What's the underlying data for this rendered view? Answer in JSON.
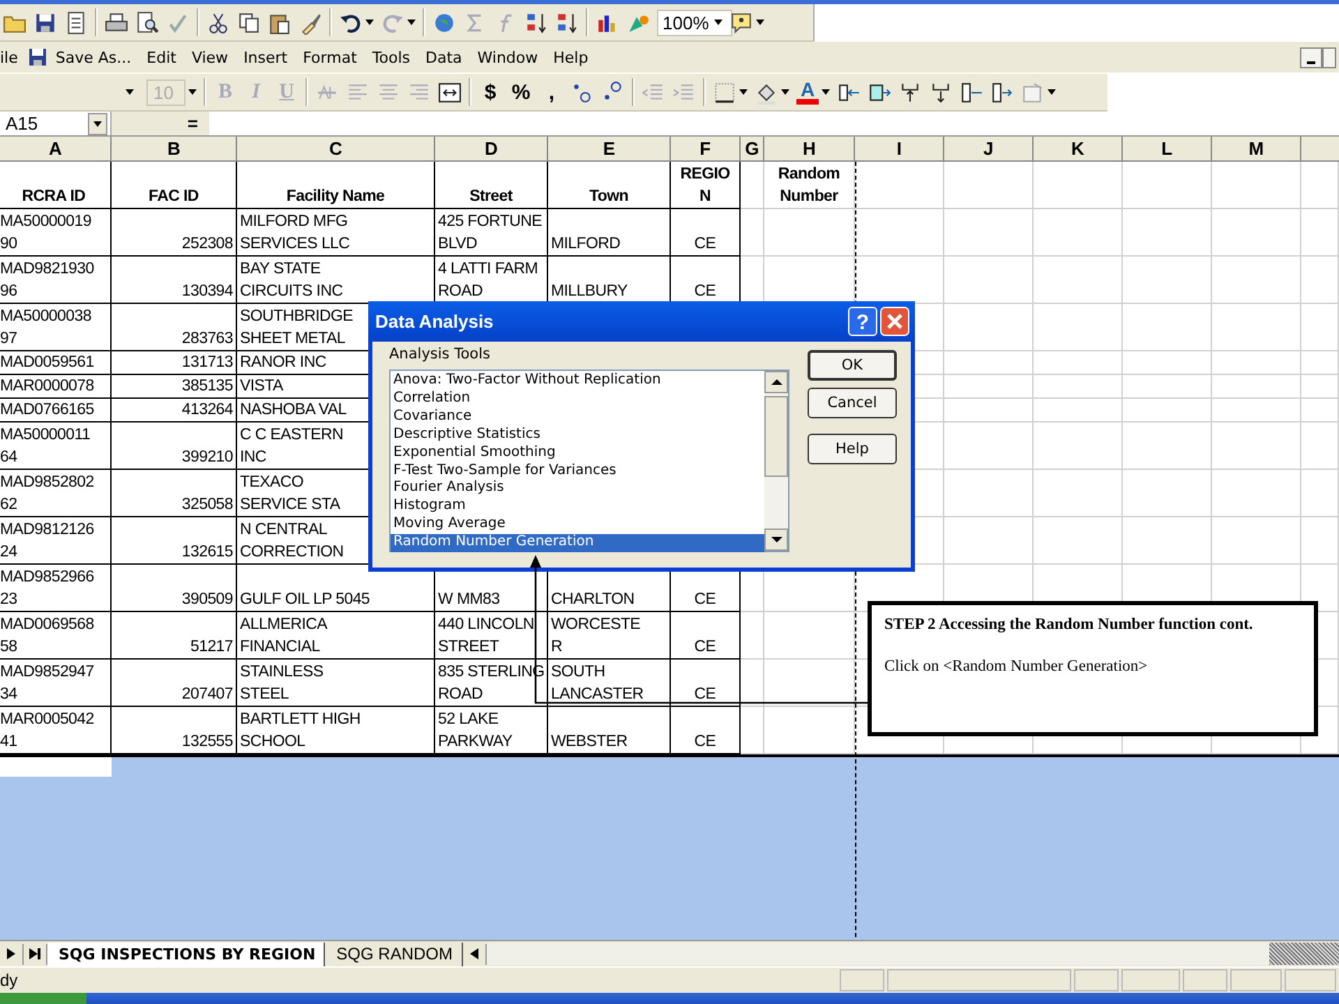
{
  "toolbar": {
    "zoom": "100%"
  },
  "menu": [
    {
      "label": "ile",
      "kind": "plain"
    },
    {
      "label": "Save As...",
      "kind": "save"
    },
    {
      "label": "Edit",
      "kind": "plain"
    },
    {
      "label": "View",
      "kind": "plain"
    },
    {
      "label": "Insert",
      "kind": "plain"
    },
    {
      "label": "Format",
      "kind": "plain"
    },
    {
      "label": "Tools",
      "kind": "plain"
    },
    {
      "label": "Data",
      "kind": "plain"
    },
    {
      "label": "Window",
      "kind": "plain"
    },
    {
      "label": "Help",
      "kind": "plain"
    }
  ],
  "format_toolbar": {
    "font_size": "10",
    "style_buttons": [
      "B",
      "I",
      "U"
    ],
    "number_buttons": [
      "$",
      "%",
      ","
    ],
    "font_color": "A"
  },
  "formula_bar": {
    "name_box": "A15",
    "equals": "="
  },
  "table": {
    "columns": [
      "A",
      "B",
      "C",
      "D",
      "E",
      "F",
      "G",
      "H",
      "I",
      "J",
      "K",
      "L",
      "M"
    ],
    "header": {
      "A": "RCRA ID",
      "B": "FAC ID",
      "C": "Facility Name",
      "D": "Street",
      "E": "Town",
      "F": "REGIO\nN",
      "H": "Random\nNumber"
    },
    "rows": [
      {
        "A": "MA50000019\n90",
        "B": "252308",
        "C": "MILFORD MFG\nSERVICES LLC",
        "D": "425 FORTUNE\nBLVD",
        "E": "MILFORD",
        "F": "CE"
      },
      {
        "A": "MAD9821930\n96",
        "B": "130394",
        "C": "BAY STATE\nCIRCUITS INC",
        "D": "4 LATTI FARM\nROAD",
        "E": "MILLBURY",
        "F": "CE"
      },
      {
        "A": "MA50000038\n97",
        "B": "283763",
        "C": "SOUTHBRIDGE\nSHEET METAL"
      },
      {
        "A": "MAD0059561",
        "B": "131713",
        "C": "RANOR INC"
      },
      {
        "A": "MAR0000078",
        "B": "385135",
        "C": "VISTA"
      },
      {
        "A": "MAD0766165",
        "B": "413264",
        "C": "NASHOBA VAL"
      },
      {
        "A": "MA50000011\n64",
        "B": "399210",
        "C": "C C EASTERN\nINC"
      },
      {
        "A": "MAD9852802\n62",
        "B": "325058",
        "C": "TEXACO\nSERVICE STA"
      },
      {
        "A": "MAD9812126\n24",
        "B": "132615",
        "C": "N CENTRAL\nCORRECTION"
      },
      {
        "A": "MAD9852966\n23",
        "B": "390509",
        "C": "GULF OIL LP 5045",
        "D": "W MM83",
        "E": "CHARLTON",
        "F": "CE"
      },
      {
        "A": "MAD0069568\n58",
        "B": "51217",
        "C": "ALLMERICA\nFINANCIAL",
        "D": "440 LINCOLN\nSTREET",
        "E": "WORCESTE\nR",
        "F": "CE"
      },
      {
        "A": "MAD9852947\n34",
        "B": "207407",
        "C": "STAINLESS\nSTEEL",
        "D": "835 STERLING\nROAD",
        "E": "SOUTH\nLANCASTER",
        "F": "CE"
      },
      {
        "A": "MAR0005042\n41",
        "B": "132555",
        "C": "BARTLETT HIGH\nSCHOOL",
        "D": "52 LAKE\nPARKWAY",
        "E": "WEBSTER",
        "F": "CE"
      }
    ]
  },
  "dialog": {
    "title": "Data Analysis",
    "help_glyph": "?",
    "list_label": "Analysis Tools",
    "items": [
      {
        "label": "Anova: Two-Factor Without Replication",
        "selected": false
      },
      {
        "label": "Correlation",
        "selected": false
      },
      {
        "label": "Covariance",
        "selected": false
      },
      {
        "label": "Descriptive Statistics",
        "selected": false
      },
      {
        "label": "Exponential Smoothing",
        "selected": false
      },
      {
        "label": "F-Test Two-Sample for Variances",
        "selected": false
      },
      {
        "label": "Fourier Analysis",
        "selected": false
      },
      {
        "label": "Histogram",
        "selected": false
      },
      {
        "label": "Moving Average",
        "selected": false
      },
      {
        "label": "Random Number Generation",
        "selected": true
      }
    ],
    "buttons": [
      "OK",
      "Cancel",
      "Help"
    ]
  },
  "callout": {
    "title": "STEP 2 Accessing the Random Number function cont.",
    "instruction": "Click on <Random Number Generation>"
  },
  "sheet_tabs": [
    {
      "label": "SQG INSPECTIONS BY REGION",
      "selected": true
    },
    {
      "label": "SQG RANDOM",
      "selected": false
    }
  ],
  "status_bar": {
    "text": "dy"
  }
}
